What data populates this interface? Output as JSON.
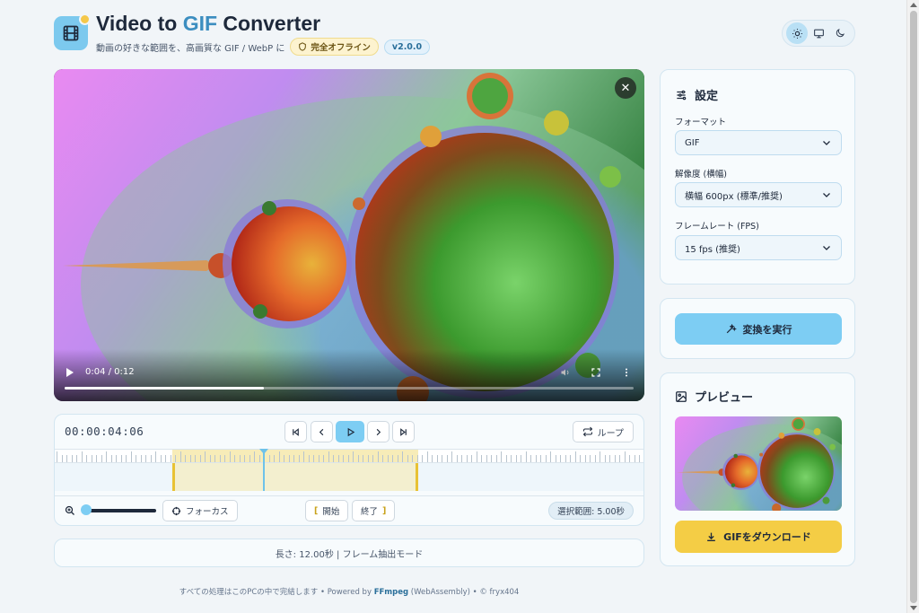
{
  "header": {
    "title_prefix": "Video to ",
    "title_accent": "GIF",
    "title_suffix": " Converter",
    "tagline": "動画の好きな範囲を、高画質な GIF / WebP に",
    "offline_badge": "完全オフライン",
    "version_badge": "v2.0.0",
    "theme_options": [
      "light",
      "system",
      "dark"
    ],
    "theme_selected": "light"
  },
  "video": {
    "time_display": "0:04 / 0:12",
    "progress": 0.35
  },
  "timeline": {
    "timecode": "00:00:04:06",
    "loop_label": "ループ",
    "focus_label": "フォーカス",
    "start_label": "開始",
    "end_label": "終了",
    "range_label": "選択範囲: 5.00秒",
    "selection_start_sec": 2.4,
    "selection_end_sec": 7.4,
    "playhead_sec": 4.25,
    "duration_sec": 12.0,
    "zoom_level": 0.0
  },
  "info_bar": "長さ: 12.00秒 | フレーム抽出モード",
  "settings": {
    "title": "設定",
    "format_label": "フォーマット",
    "format_value": "GIF",
    "resolution_label": "解像度 (横幅)",
    "resolution_value": "横幅 600px (標準/推奨)",
    "fps_label": "フレームレート (FPS)",
    "fps_value": "15 fps (推奨)"
  },
  "actions": {
    "execute_label": "変換を実行"
  },
  "preview": {
    "title": "プレビュー",
    "download_label": "GIFをダウンロード"
  },
  "footer": {
    "text_before": "すべての処理はこのPCの中で完結します • Powered by ",
    "ffmpeg": "FFmpeg",
    "text_after": " (WebAssembly) • © fryx404"
  },
  "colors": {
    "accent": "#7dcdf3",
    "download": "#f4cd45",
    "selection_handle": "#e8c234"
  }
}
